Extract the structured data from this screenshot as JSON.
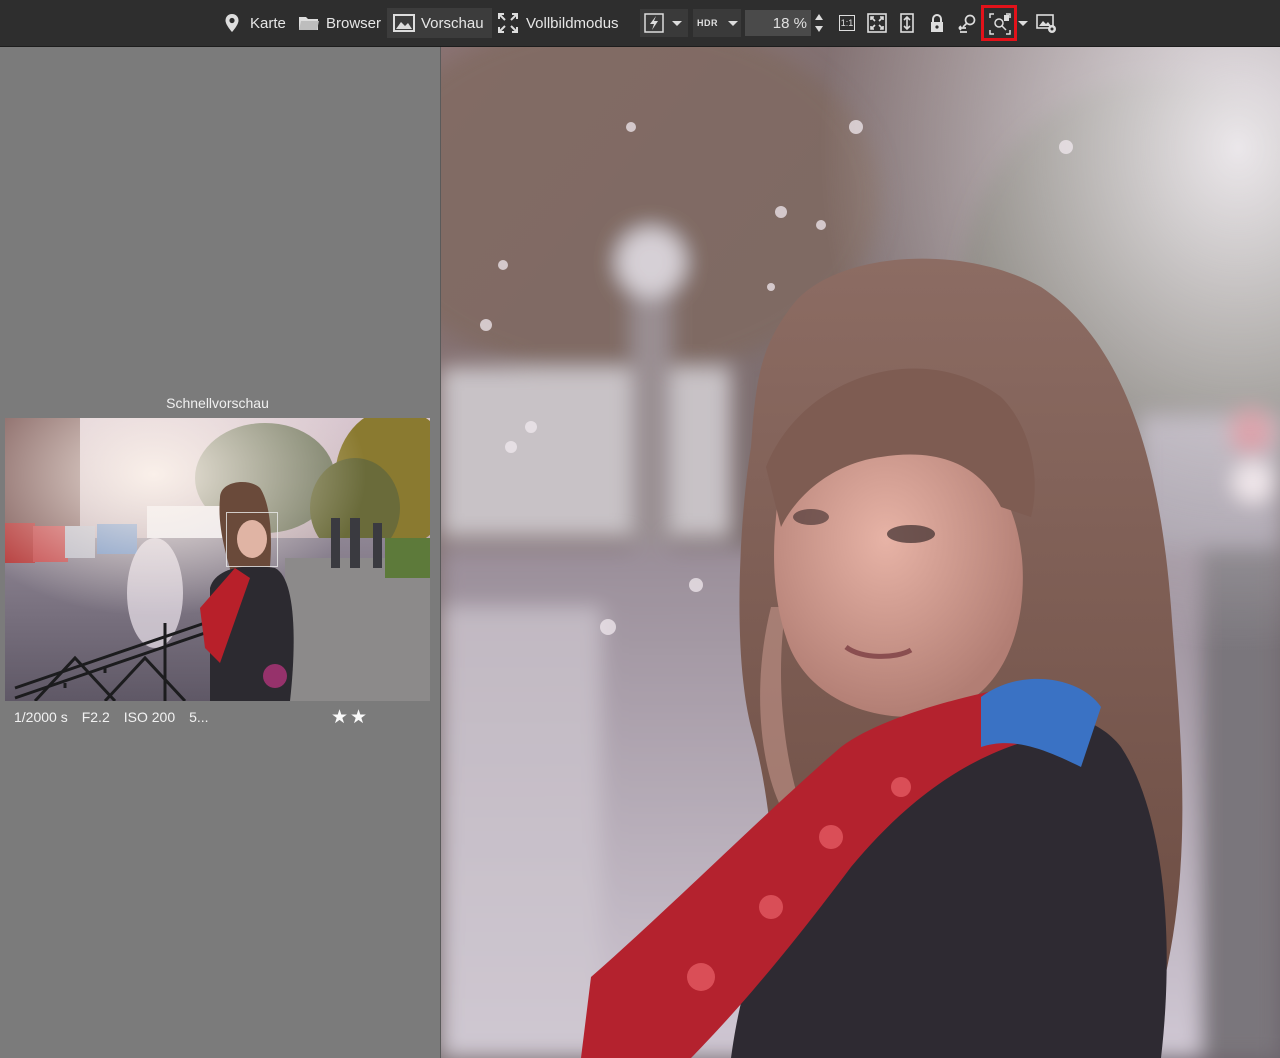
{
  "toolbar": {
    "map_label": "Karte",
    "browser_label": "Browser",
    "preview_label": "Vorschau",
    "fullscreen_label": "Vollbildmodus",
    "hdr_label": "HDR",
    "zoom_value": "18 %",
    "one_to_one_label": "1:1"
  },
  "left_panel": {
    "title": "Schnellvorschau",
    "shutter": "1/2000 s",
    "aperture": "F2.2",
    "iso": "ISO 200",
    "more": "5...",
    "stars": "★★",
    "rating": 2
  },
  "icons": {
    "map": "map-pin-icon",
    "browser": "folder-icon",
    "preview": "image-icon",
    "fullscreen": "expand-icon",
    "flash": "flash-icon",
    "lock": "lock-icon",
    "zoom_tool": "zoom-tool-icon",
    "auto_zoom": "auto-zoom-icon",
    "settings": "image-settings-icon"
  },
  "colors": {
    "toolbar_bg": "#2e2e2e",
    "panel_bg": "#7b7b7b",
    "highlight": "#e3121a"
  }
}
